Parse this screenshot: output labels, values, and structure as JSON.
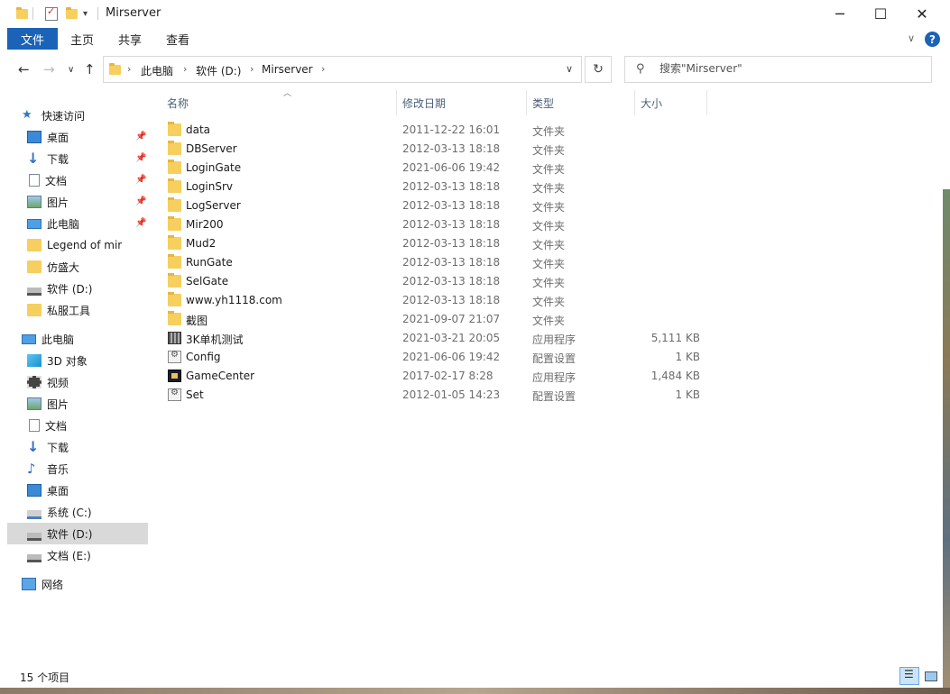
{
  "window": {
    "title": "Mirserver"
  },
  "ribbon": {
    "tabs": [
      "文件",
      "主页",
      "共享",
      "查看"
    ]
  },
  "address": {
    "crumbs": [
      "此电脑",
      "软件 (D:)",
      "Mirserver"
    ]
  },
  "search": {
    "placeholder": "搜索\"Mirserver\""
  },
  "sidebar": {
    "items": [
      {
        "label": "快速访问",
        "icon": "star-icon"
      },
      {
        "label": "桌面",
        "icon": "desktop-icon"
      },
      {
        "label": "下载",
        "icon": "download-icon"
      },
      {
        "label": "文档",
        "icon": "document-icon"
      },
      {
        "label": "图片",
        "icon": "picture-icon"
      },
      {
        "label": "此电脑",
        "icon": "computer-icon"
      },
      {
        "label": "Legend of mir",
        "icon": "folder-icon"
      },
      {
        "label": "仿盛大",
        "icon": "folder-icon"
      },
      {
        "label": "软件 (D:)",
        "icon": "drive-icon"
      },
      {
        "label": "私服工具",
        "icon": "folder-icon"
      },
      {
        "label": "此电脑",
        "icon": "computer-icon"
      },
      {
        "label": "3D 对象",
        "icon": "cube-icon"
      },
      {
        "label": "视频",
        "icon": "video-icon"
      },
      {
        "label": "图片",
        "icon": "picture-icon"
      },
      {
        "label": "文档",
        "icon": "document-icon"
      },
      {
        "label": "下载",
        "icon": "download-icon"
      },
      {
        "label": "音乐",
        "icon": "music-icon"
      },
      {
        "label": "桌面",
        "icon": "desktop-icon"
      },
      {
        "label": "系统 (C:)",
        "icon": "system-drive-icon"
      },
      {
        "label": "软件 (D:)",
        "icon": "drive-icon"
      },
      {
        "label": "文档 (E:)",
        "icon": "drive-icon"
      },
      {
        "label": "网络",
        "icon": "network-icon"
      }
    ]
  },
  "columns": {
    "name": "名称",
    "date": "修改日期",
    "type": "类型",
    "size": "大小"
  },
  "files": [
    {
      "name": "data",
      "date": "2011-12-22 16:01",
      "type": "文件夹",
      "size": "",
      "icon": "folder-icon"
    },
    {
      "name": "DBServer",
      "date": "2012-03-13 18:18",
      "type": "文件夹",
      "size": "",
      "icon": "folder-icon"
    },
    {
      "name": "LoginGate",
      "date": "2021-06-06 19:42",
      "type": "文件夹",
      "size": "",
      "icon": "folder-icon"
    },
    {
      "name": "LoginSrv",
      "date": "2012-03-13 18:18",
      "type": "文件夹",
      "size": "",
      "icon": "folder-icon"
    },
    {
      "name": "LogServer",
      "date": "2012-03-13 18:18",
      "type": "文件夹",
      "size": "",
      "icon": "folder-icon"
    },
    {
      "name": "Mir200",
      "date": "2012-03-13 18:18",
      "type": "文件夹",
      "size": "",
      "icon": "folder-icon"
    },
    {
      "name": "Mud2",
      "date": "2012-03-13 18:18",
      "type": "文件夹",
      "size": "",
      "icon": "folder-icon"
    },
    {
      "name": "RunGate",
      "date": "2012-03-13 18:18",
      "type": "文件夹",
      "size": "",
      "icon": "folder-icon"
    },
    {
      "name": "SelGate",
      "date": "2012-03-13 18:18",
      "type": "文件夹",
      "size": "",
      "icon": "folder-icon"
    },
    {
      "name": "www.yh1118.com",
      "date": "2012-03-13 18:18",
      "type": "文件夹",
      "size": "",
      "icon": "folder-icon"
    },
    {
      "name": "截图",
      "date": "2021-09-07 21:07",
      "type": "文件夹",
      "size": "",
      "icon": "folder-icon"
    },
    {
      "name": "3K单机测试",
      "date": "2021-03-21 20:05",
      "type": "应用程序",
      "size": "5,111 KB",
      "icon": "application-icon"
    },
    {
      "name": "Config",
      "date": "2021-06-06 19:42",
      "type": "配置设置",
      "size": "1 KB",
      "icon": "config-file-icon"
    },
    {
      "name": "GameCenter",
      "date": "2017-02-17 8:28",
      "type": "应用程序",
      "size": "1,484 KB",
      "icon": "application-icon"
    },
    {
      "name": "Set",
      "date": "2012-01-05 14:23",
      "type": "配置设置",
      "size": "1 KB",
      "icon": "config-file-icon"
    }
  ],
  "status": {
    "count": "15 个项目"
  },
  "colors": {
    "accent": "#1a63b8",
    "selection": "#d9d9d9",
    "folder": "#f6cf5e"
  }
}
